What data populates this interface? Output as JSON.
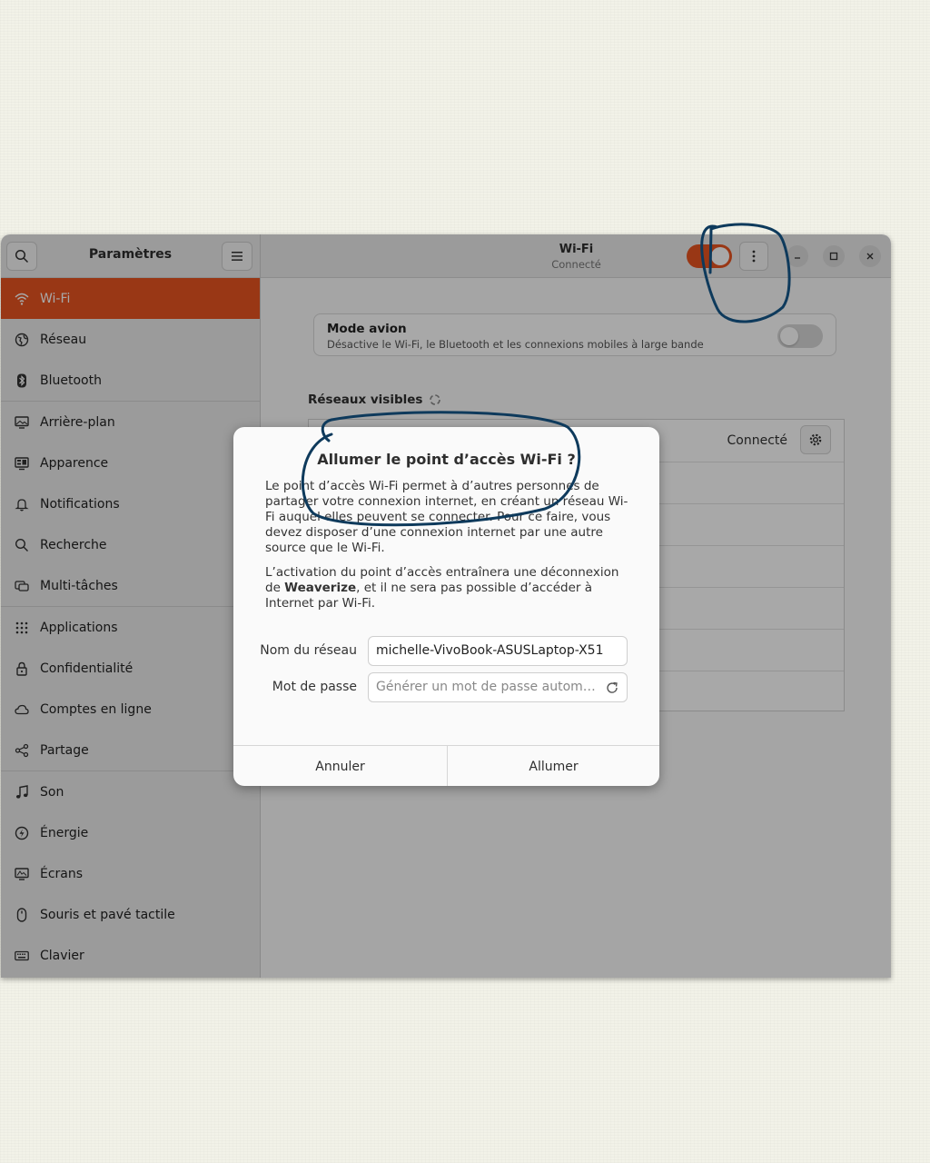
{
  "sidebar": {
    "title": "Paramètres",
    "items": [
      {
        "label": "Wi-Fi",
        "icon": "wifi-icon",
        "active": true
      },
      {
        "label": "Réseau",
        "icon": "globe-icon"
      },
      {
        "label": "Bluetooth",
        "icon": "bluetooth-icon"
      },
      {
        "label": "Arrière-plan",
        "icon": "monitor-icon"
      },
      {
        "label": "Apparence",
        "icon": "appearance-icon"
      },
      {
        "label": "Notifications",
        "icon": "bell-icon"
      },
      {
        "label": "Recherche",
        "icon": "search-icon"
      },
      {
        "label": "Multi-tâches",
        "icon": "multitasking-icon"
      },
      {
        "label": "Applications",
        "icon": "apps-grid-icon"
      },
      {
        "label": "Confidentialité",
        "icon": "lock-icon"
      },
      {
        "label": "Comptes en ligne",
        "icon": "cloud-icon"
      },
      {
        "label": "Partage",
        "icon": "share-icon"
      },
      {
        "label": "Son",
        "icon": "music-note-icon"
      },
      {
        "label": "Énergie",
        "icon": "power-icon"
      },
      {
        "label": "Écrans",
        "icon": "display-icon"
      },
      {
        "label": "Souris et pavé tactile",
        "icon": "mouse-icon"
      },
      {
        "label": "Clavier",
        "icon": "keyboard-icon"
      }
    ]
  },
  "header": {
    "title": "Wi-Fi",
    "subtitle": "Connecté",
    "wifi_enabled": true
  },
  "airplane": {
    "title": "Mode avion",
    "description": "Désactive le Wi-Fi, le Bluetooth et les connexions mobiles à large bande",
    "enabled": false
  },
  "networks": {
    "label": "Réseaux visibles",
    "connected_status": "Connecté"
  },
  "dialog": {
    "title": "Allumer le point d’accès Wi-Fi ?",
    "paragraph1": "Le point d’accès Wi-Fi permet à d’autres personnes de partager votre connexion internet, en créant un réseau Wi-Fi auquel elles peuvent se connecter. Pour ce faire, vous devez disposer d’une connexion internet par une autre source que le Wi-Fi.",
    "paragraph2_before": "L’activation du point d’accès entraînera une déconnexion de ",
    "paragraph2_network": "Weaverize",
    "paragraph2_after": ", et il ne sera pas possible d’accéder à Internet par Wi-Fi.",
    "network_name_label": "Nom du réseau",
    "network_name_value": "michelle-VivoBook-ASUSLaptop-X51",
    "password_label": "Mot de passe",
    "password_placeholder": "Générer un mot de passe automatiquement",
    "cancel_label": "Annuler",
    "confirm_label": "Allumer"
  },
  "colors": {
    "accent": "#e95420",
    "annotation_ink": "#0e3a5c",
    "page_background": "#f2f2e8"
  }
}
